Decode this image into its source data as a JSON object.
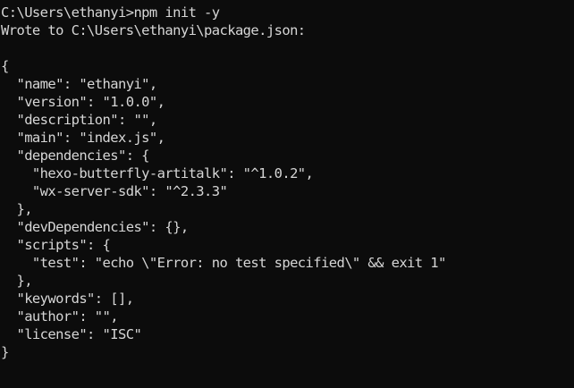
{
  "terminal": {
    "background": "#0c0c0c",
    "foreground": "#d6d6d6",
    "lines": [
      "C:\\Users\\ethanyi>npm init -y",
      "Wrote to C:\\Users\\ethanyi\\package.json:",
      "",
      "{",
      "  \"name\": \"ethanyi\",",
      "  \"version\": \"1.0.0\",",
      "  \"description\": \"\",",
      "  \"main\": \"index.js\",",
      "  \"dependencies\": {",
      "    \"hexo-butterfly-artitalk\": \"^1.0.2\",",
      "    \"wx-server-sdk\": \"^2.3.3\"",
      "  },",
      "  \"devDependencies\": {},",
      "  \"scripts\": {",
      "    \"test\": \"echo \\\"Error: no test specified\\\" && exit 1\"",
      "  },",
      "  \"keywords\": [],",
      "  \"author\": \"\",",
      "  \"license\": \"ISC\"",
      "}"
    ]
  }
}
